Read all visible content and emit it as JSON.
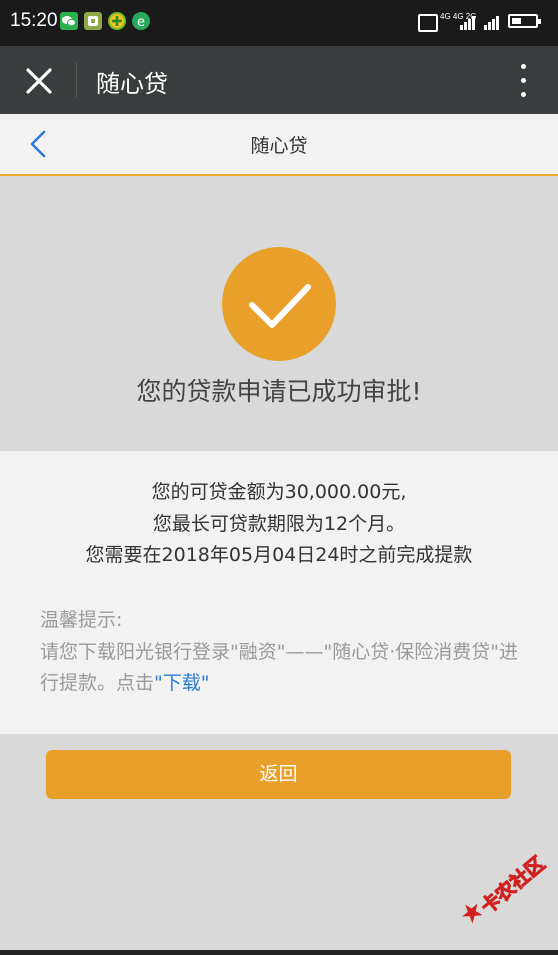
{
  "status_bar": {
    "time": "15:20",
    "network_label": "4G 4G 2G",
    "notification_icons": [
      "wechat-icon",
      "app-icon",
      "green-plus-icon",
      "browser-icon"
    ]
  },
  "toolbar": {
    "title": "随心贷",
    "close_icon": "close-icon",
    "more_icon": "more-vertical-icon"
  },
  "page_header": {
    "title": "随心贷",
    "back_icon": "chevron-left-icon"
  },
  "success": {
    "icon": "checkmark-icon",
    "message": "您的贷款申请已成功审批!"
  },
  "info": {
    "line1": "您的可贷金额为30,000.00元,",
    "line2": "您最长可贷款期限为12个月。",
    "line3": "您需要在2018年05月04日24时之前完成提款"
  },
  "tips": {
    "title": "温馨提示:",
    "body_prefix": "请您下载阳光银行登录\"融资\"——\"随心贷·保险消费贷\"进行提款。点击",
    "link_text": "\"下载\""
  },
  "return_button": {
    "label": "返回"
  },
  "watermark": {
    "text": "卡农社区"
  },
  "colors": {
    "accent": "#e9a02b",
    "link": "#2a7bd2",
    "toolbar": "#3a3d3e",
    "status_bar": "#1a1a1a"
  }
}
